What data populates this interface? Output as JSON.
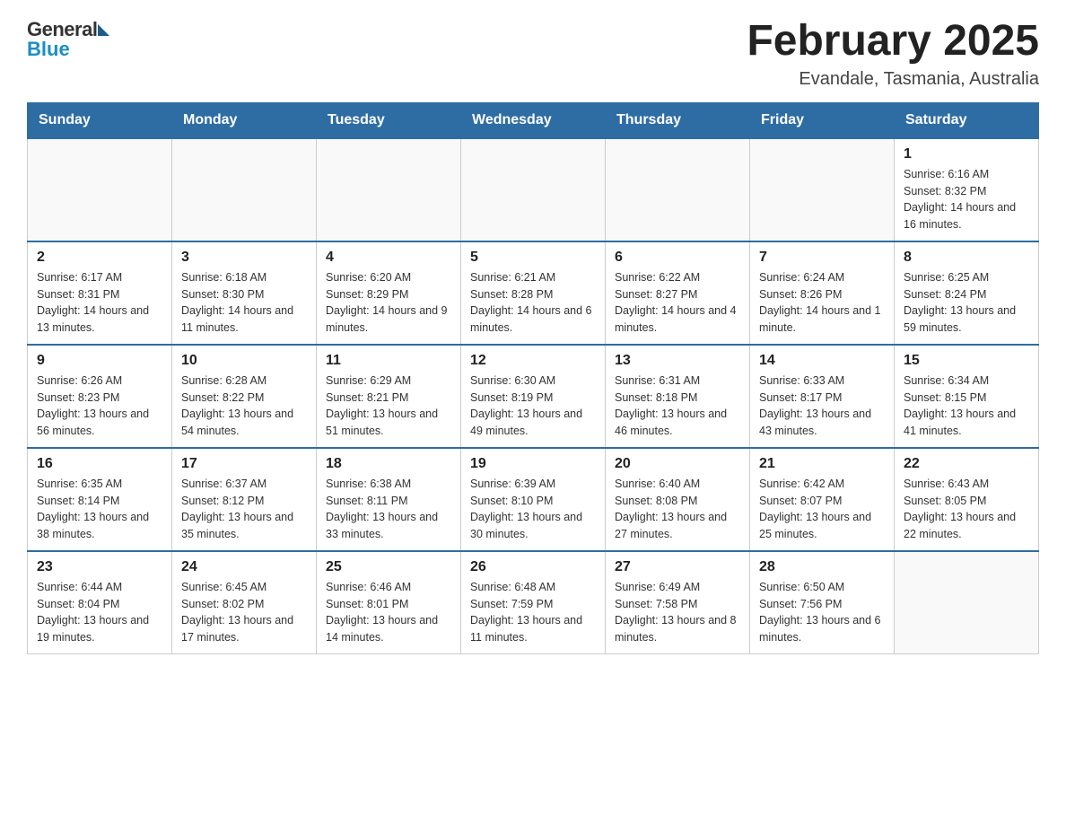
{
  "header": {
    "month_title": "February 2025",
    "location": "Evandale, Tasmania, Australia"
  },
  "logo": {
    "general": "General",
    "blue": "Blue"
  },
  "days_of_week": [
    "Sunday",
    "Monday",
    "Tuesday",
    "Wednesday",
    "Thursday",
    "Friday",
    "Saturday"
  ],
  "weeks": [
    {
      "days": [
        {
          "number": "",
          "info": ""
        },
        {
          "number": "",
          "info": ""
        },
        {
          "number": "",
          "info": ""
        },
        {
          "number": "",
          "info": ""
        },
        {
          "number": "",
          "info": ""
        },
        {
          "number": "",
          "info": ""
        },
        {
          "number": "1",
          "info": "Sunrise: 6:16 AM\nSunset: 8:32 PM\nDaylight: 14 hours and 16 minutes."
        }
      ]
    },
    {
      "days": [
        {
          "number": "2",
          "info": "Sunrise: 6:17 AM\nSunset: 8:31 PM\nDaylight: 14 hours and 13 minutes."
        },
        {
          "number": "3",
          "info": "Sunrise: 6:18 AM\nSunset: 8:30 PM\nDaylight: 14 hours and 11 minutes."
        },
        {
          "number": "4",
          "info": "Sunrise: 6:20 AM\nSunset: 8:29 PM\nDaylight: 14 hours and 9 minutes."
        },
        {
          "number": "5",
          "info": "Sunrise: 6:21 AM\nSunset: 8:28 PM\nDaylight: 14 hours and 6 minutes."
        },
        {
          "number": "6",
          "info": "Sunrise: 6:22 AM\nSunset: 8:27 PM\nDaylight: 14 hours and 4 minutes."
        },
        {
          "number": "7",
          "info": "Sunrise: 6:24 AM\nSunset: 8:26 PM\nDaylight: 14 hours and 1 minute."
        },
        {
          "number": "8",
          "info": "Sunrise: 6:25 AM\nSunset: 8:24 PM\nDaylight: 13 hours and 59 minutes."
        }
      ]
    },
    {
      "days": [
        {
          "number": "9",
          "info": "Sunrise: 6:26 AM\nSunset: 8:23 PM\nDaylight: 13 hours and 56 minutes."
        },
        {
          "number": "10",
          "info": "Sunrise: 6:28 AM\nSunset: 8:22 PM\nDaylight: 13 hours and 54 minutes."
        },
        {
          "number": "11",
          "info": "Sunrise: 6:29 AM\nSunset: 8:21 PM\nDaylight: 13 hours and 51 minutes."
        },
        {
          "number": "12",
          "info": "Sunrise: 6:30 AM\nSunset: 8:19 PM\nDaylight: 13 hours and 49 minutes."
        },
        {
          "number": "13",
          "info": "Sunrise: 6:31 AM\nSunset: 8:18 PM\nDaylight: 13 hours and 46 minutes."
        },
        {
          "number": "14",
          "info": "Sunrise: 6:33 AM\nSunset: 8:17 PM\nDaylight: 13 hours and 43 minutes."
        },
        {
          "number": "15",
          "info": "Sunrise: 6:34 AM\nSunset: 8:15 PM\nDaylight: 13 hours and 41 minutes."
        }
      ]
    },
    {
      "days": [
        {
          "number": "16",
          "info": "Sunrise: 6:35 AM\nSunset: 8:14 PM\nDaylight: 13 hours and 38 minutes."
        },
        {
          "number": "17",
          "info": "Sunrise: 6:37 AM\nSunset: 8:12 PM\nDaylight: 13 hours and 35 minutes."
        },
        {
          "number": "18",
          "info": "Sunrise: 6:38 AM\nSunset: 8:11 PM\nDaylight: 13 hours and 33 minutes."
        },
        {
          "number": "19",
          "info": "Sunrise: 6:39 AM\nSunset: 8:10 PM\nDaylight: 13 hours and 30 minutes."
        },
        {
          "number": "20",
          "info": "Sunrise: 6:40 AM\nSunset: 8:08 PM\nDaylight: 13 hours and 27 minutes."
        },
        {
          "number": "21",
          "info": "Sunrise: 6:42 AM\nSunset: 8:07 PM\nDaylight: 13 hours and 25 minutes."
        },
        {
          "number": "22",
          "info": "Sunrise: 6:43 AM\nSunset: 8:05 PM\nDaylight: 13 hours and 22 minutes."
        }
      ]
    },
    {
      "days": [
        {
          "number": "23",
          "info": "Sunrise: 6:44 AM\nSunset: 8:04 PM\nDaylight: 13 hours and 19 minutes."
        },
        {
          "number": "24",
          "info": "Sunrise: 6:45 AM\nSunset: 8:02 PM\nDaylight: 13 hours and 17 minutes."
        },
        {
          "number": "25",
          "info": "Sunrise: 6:46 AM\nSunset: 8:01 PM\nDaylight: 13 hours and 14 minutes."
        },
        {
          "number": "26",
          "info": "Sunrise: 6:48 AM\nSunset: 7:59 PM\nDaylight: 13 hours and 11 minutes."
        },
        {
          "number": "27",
          "info": "Sunrise: 6:49 AM\nSunset: 7:58 PM\nDaylight: 13 hours and 8 minutes."
        },
        {
          "number": "28",
          "info": "Sunrise: 6:50 AM\nSunset: 7:56 PM\nDaylight: 13 hours and 6 minutes."
        },
        {
          "number": "",
          "info": ""
        }
      ]
    }
  ]
}
